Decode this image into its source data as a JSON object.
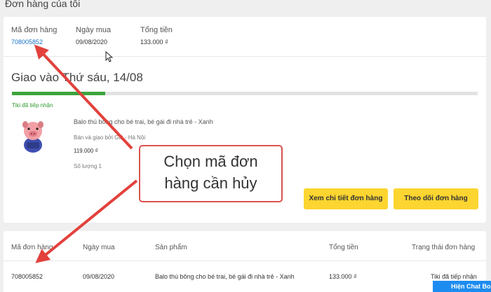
{
  "page_title": "Đơn hàng của tôi",
  "order_header": {
    "id_label": "Mã đơn hàng",
    "id_value": "708005852",
    "date_label": "Ngày mua",
    "date_value": "09/08/2020",
    "total_label": "Tổng tiền",
    "total_value": "133.000 ₫"
  },
  "delivery": {
    "title": "Giao vào Thứ sáu, 14/08",
    "progress": 0.2,
    "status": "Tiki đã tiếp nhận"
  },
  "product": {
    "name": "Balo thú bông cho bé trai, bé gái đi nhà trẻ - Xanh",
    "seller": "Bán và giao bởi Gift - Hà Nội",
    "price": "119.000 ₫",
    "quantity": "Số lượng 1"
  },
  "actions": {
    "detail_label": "Xem chi tiết đơn hàng",
    "track_label": "Theo dõi đơn hàng"
  },
  "callout": {
    "line1": "Chọn mã đơn",
    "line2": "hàng cần hủy"
  },
  "order_table": {
    "headers": [
      "Mã đơn hàng",
      "Ngày mua",
      "Sản phẩm",
      "Tổng tiền",
      "Trạng thái đơn hàng"
    ],
    "rows": [
      {
        "id": "708005852",
        "date": "09/08/2020",
        "product": "Balo thú bông cho bé trai, bé gái đi nhà trẻ - Xanh",
        "total": "133.000 ₫",
        "status": "Tiki đã tiếp nhận"
      }
    ]
  },
  "chat_button": "Hiện Chat Bo",
  "colors": {
    "accent_yellow": "#fcd530",
    "link_blue": "#1a73c8",
    "progress_green": "#3ca43c",
    "annotation_red": "#d9534f",
    "chat_blue": "#1d8cf0"
  }
}
